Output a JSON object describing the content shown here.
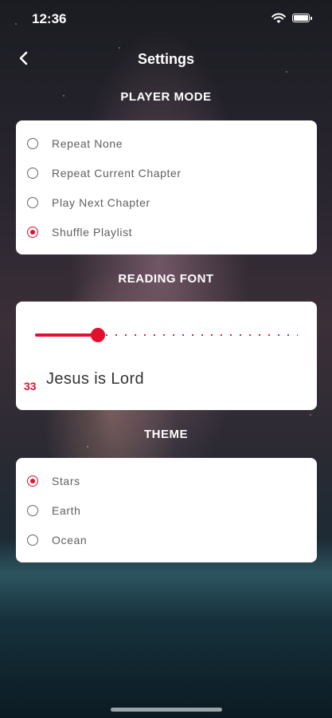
{
  "status": {
    "time": "12:36"
  },
  "nav": {
    "title": "Settings"
  },
  "player_mode": {
    "title": "PLAYER MODE",
    "options": [
      {
        "label": "Repeat None",
        "selected": false
      },
      {
        "label": "Repeat Current Chapter",
        "selected": false
      },
      {
        "label": "Play Next Chapter",
        "selected": false
      },
      {
        "label": "Shuffle Playlist",
        "selected": true
      }
    ]
  },
  "reading_font": {
    "title": "READING FONT",
    "size_value": "33",
    "slider_fraction": 0.24,
    "preview_text": "Jesus is Lord"
  },
  "theme": {
    "title": "THEME",
    "options": [
      {
        "label": "Stars",
        "selected": true
      },
      {
        "label": "Earth",
        "selected": false
      },
      {
        "label": "Ocean",
        "selected": false
      }
    ]
  },
  "colors": {
    "accent": "#e0102e",
    "card": "#ffffff"
  }
}
